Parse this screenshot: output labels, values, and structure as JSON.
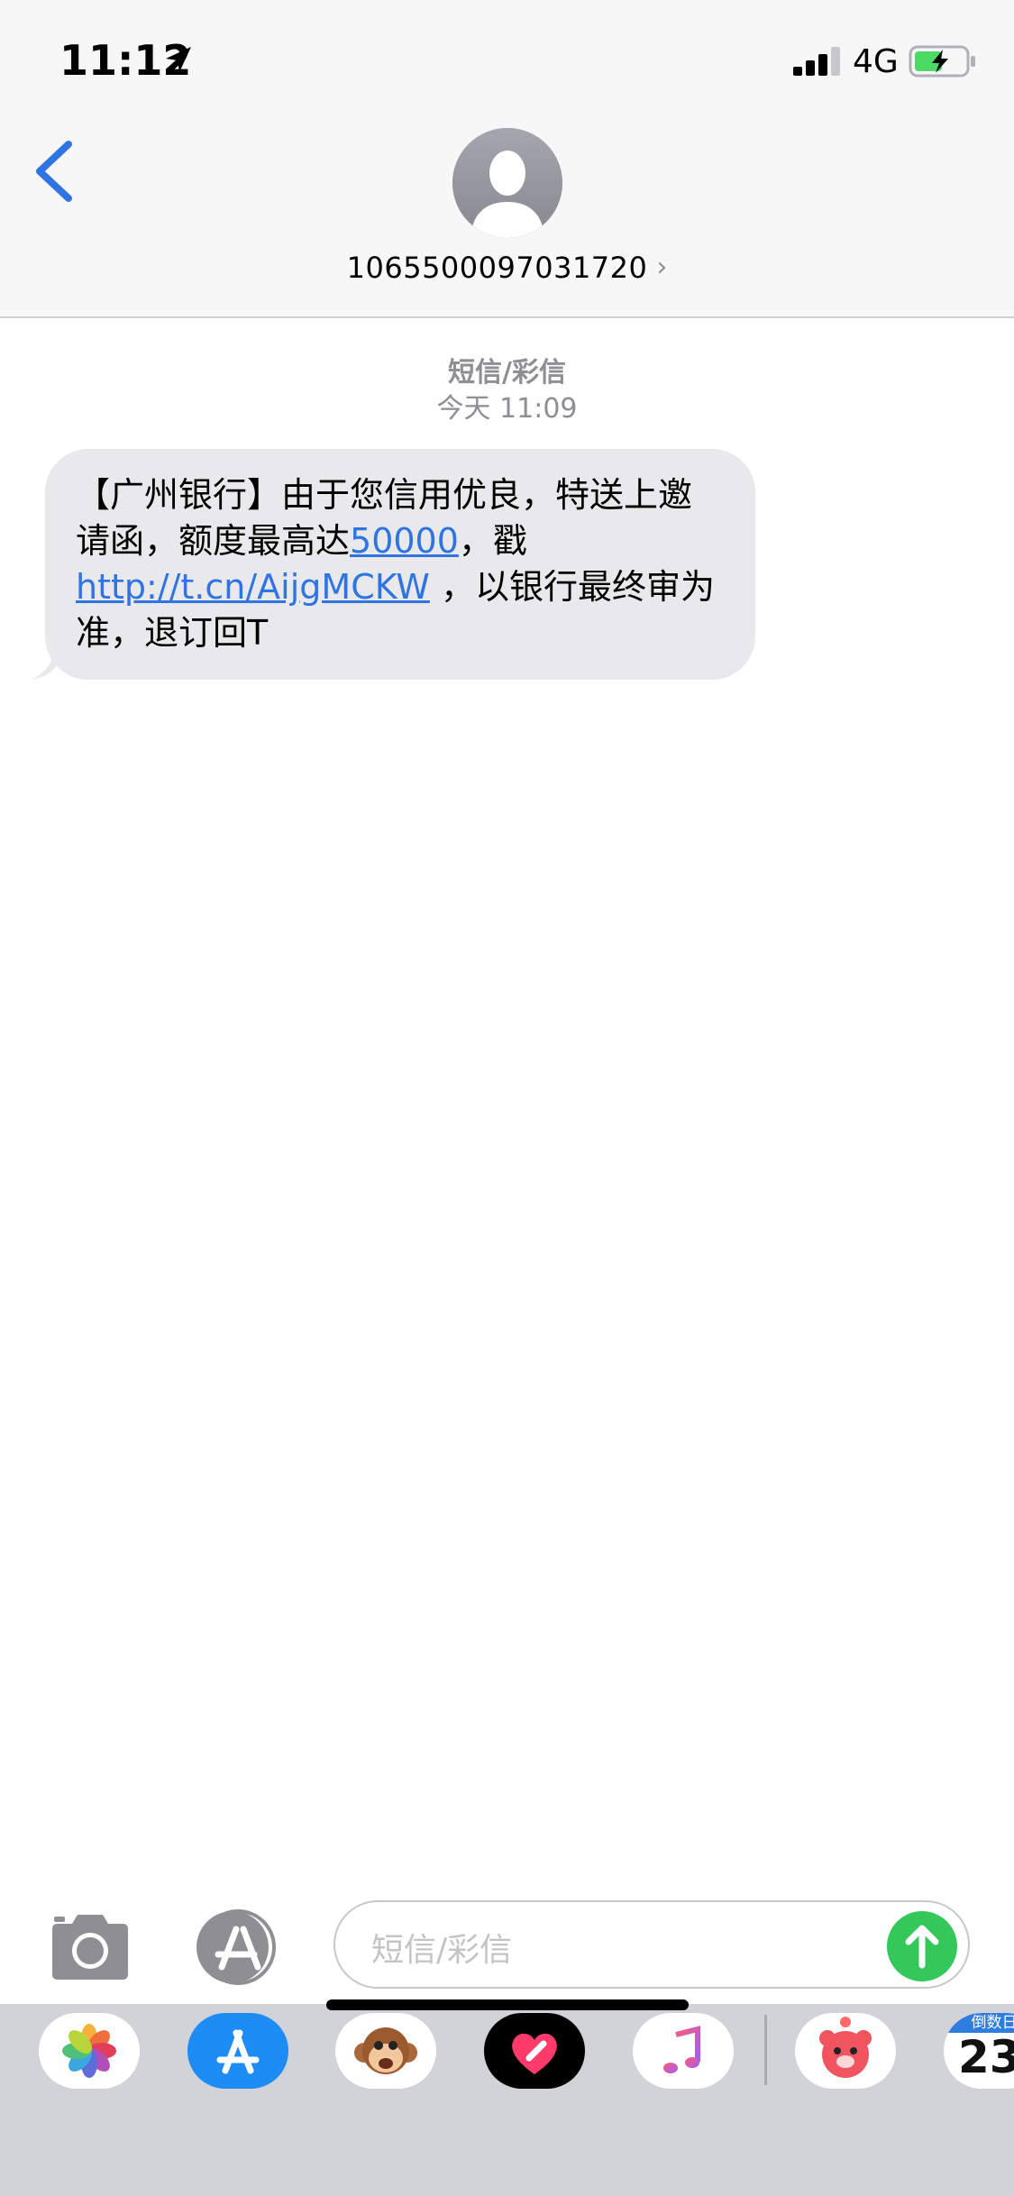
{
  "status_bar": {
    "time": "11:12",
    "network": "4G"
  },
  "header": {
    "contact_name": "1065500097031720",
    "chevron": "›"
  },
  "conversation": {
    "message_type": "短信/彩信",
    "timestamp": "今天 11:09",
    "messages": [
      {
        "direction": "incoming",
        "text_part1": "【广州银行】由于您信用优良，特送上邀请函，额度最高达",
        "link_amount": "50000",
        "text_part2": "，戳",
        "link_url": "http://t.cn/AijgMCKW",
        "text_part3": " ，以银行最终审为准，退订回T"
      }
    ]
  },
  "input_bar": {
    "placeholder": "短信/彩信"
  },
  "app_drawer": {
    "apps": [
      {
        "name": "photos-app"
      },
      {
        "name": "app-store-app"
      },
      {
        "name": "animoji-app"
      },
      {
        "name": "digital-touch-app"
      },
      {
        "name": "music-app"
      },
      {
        "name": "bear-sticker-app"
      },
      {
        "name": "countdown-app"
      }
    ],
    "countdown_label": "倒数日",
    "countdown_value": "23"
  },
  "colors": {
    "accent": "#2f74e3",
    "send": "#34c759",
    "bubble": "#e9e9eb",
    "header_bg": "#f7f7f8",
    "drawer_bg": "#d1d3d8"
  },
  "icons": {
    "back": "chevron-left-icon",
    "location": "location-arrow-icon",
    "signal": "cellular-signal-icon",
    "battery": "battery-charging-icon",
    "avatar": "person-silhouette-icon",
    "camera": "camera-icon",
    "appstore": "app-store-icon",
    "send": "arrow-up-icon"
  }
}
